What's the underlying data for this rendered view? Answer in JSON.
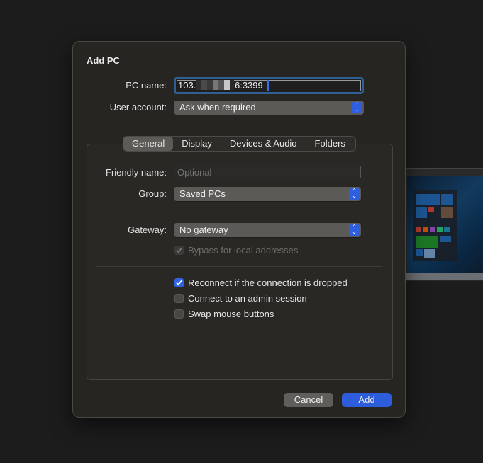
{
  "dialog": {
    "title": "Add PC",
    "pc_name": {
      "label": "PC name:",
      "value_prefix": "103.",
      "value_suffix": "6:3399"
    },
    "user_account": {
      "label": "User account:",
      "selected": "Ask when required"
    },
    "tabs": [
      {
        "label": "General",
        "active": true
      },
      {
        "label": "Display",
        "active": false
      },
      {
        "label": "Devices & Audio",
        "active": false
      },
      {
        "label": "Folders",
        "active": false
      }
    ],
    "general": {
      "friendly_name": {
        "label": "Friendly name:",
        "value": "",
        "placeholder": "Optional"
      },
      "group": {
        "label": "Group:",
        "selected": "Saved PCs"
      },
      "gateway": {
        "label": "Gateway:",
        "selected": "No gateway"
      },
      "bypass": {
        "label": "Bypass for local addresses",
        "checked": true,
        "enabled": false
      },
      "options": [
        {
          "label": "Reconnect if the connection is dropped",
          "checked": true
        },
        {
          "label": "Connect to an admin session",
          "checked": false
        },
        {
          "label": "Swap mouse buttons",
          "checked": false
        }
      ]
    },
    "buttons": {
      "cancel": "Cancel",
      "add": "Add"
    }
  },
  "colors": {
    "accent": "#2d5ddb",
    "dialog_bg": "#272522",
    "desktop_bg": "#1c1c1c"
  }
}
